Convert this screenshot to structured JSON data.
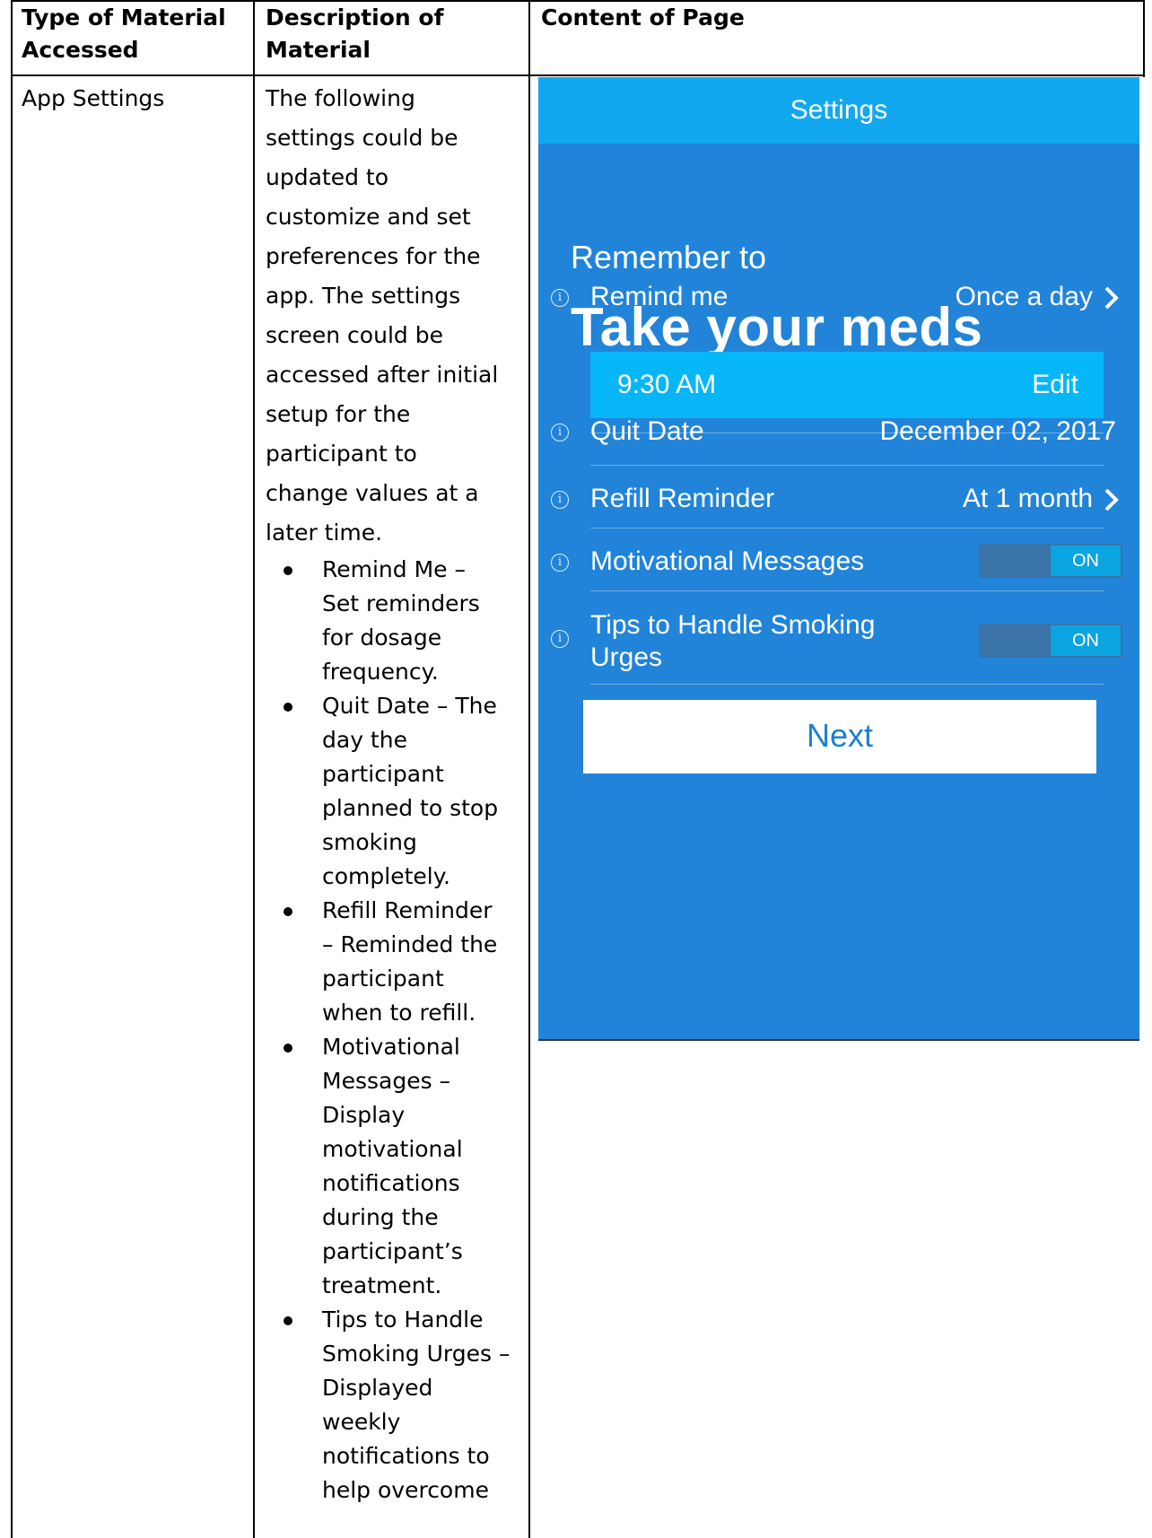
{
  "table": {
    "headers": [
      "Type of Material Accessed",
      "Description of Material",
      "Content of Page"
    ],
    "header_lines": [
      [
        "Type of Material",
        "Accessed"
      ],
      [
        "Description of",
        "Material"
      ],
      [
        "Content of Page"
      ]
    ],
    "type": "App Settings",
    "description_lines": [
      "The following",
      "settings could be",
      "updated to",
      "customize and set",
      "preferences for the",
      "app. The settings",
      "screen could be",
      "accessed after initial",
      "setup for the",
      "participant to",
      "change values at a",
      "later time."
    ],
    "bullets": [
      [
        "Remind Me –",
        "Set reminders",
        "for dosage",
        "frequency."
      ],
      [
        "Quit Date – The",
        "day the",
        "participant",
        "planned to stop",
        "smoking",
        "completely."
      ],
      [
        "Refill Reminder",
        "– Reminded the",
        "participant",
        "when to refill."
      ],
      [
        "Motivational",
        "Messages –",
        "Display",
        "motivational",
        "notifications",
        "during the",
        "participant’s",
        "treatment."
      ],
      [
        "Tips to Handle",
        "Smoking Urges –",
        "Displayed",
        "weekly",
        "notifications to",
        "help overcome"
      ]
    ]
  },
  "app": {
    "title": "Settings",
    "remember": "Remember to",
    "headline": "Take your meds",
    "remind": {
      "label": "Remind me",
      "value": "Once a day"
    },
    "time": {
      "value": "9:30 AM",
      "edit": "Edit"
    },
    "quit": {
      "label": "Quit Date",
      "value": "December 02,  2017"
    },
    "refill": {
      "label": "Refill Reminder",
      "value": "At 1 month"
    },
    "motivational": {
      "label": "Motivational Messages",
      "toggle": "ON"
    },
    "tips": {
      "label_line1": "Tips to Handle Smoking",
      "label_line2": "Urges",
      "toggle": "ON"
    },
    "next": "Next",
    "info_glyph": "i",
    "colors": {
      "background": "#2184d9",
      "topbar": "#12a8f0",
      "time_box": "#07b6f7",
      "toggle_on": "#0aa4e0"
    },
    "icons": [
      "info-icon",
      "chevron-right-icon"
    ]
  }
}
